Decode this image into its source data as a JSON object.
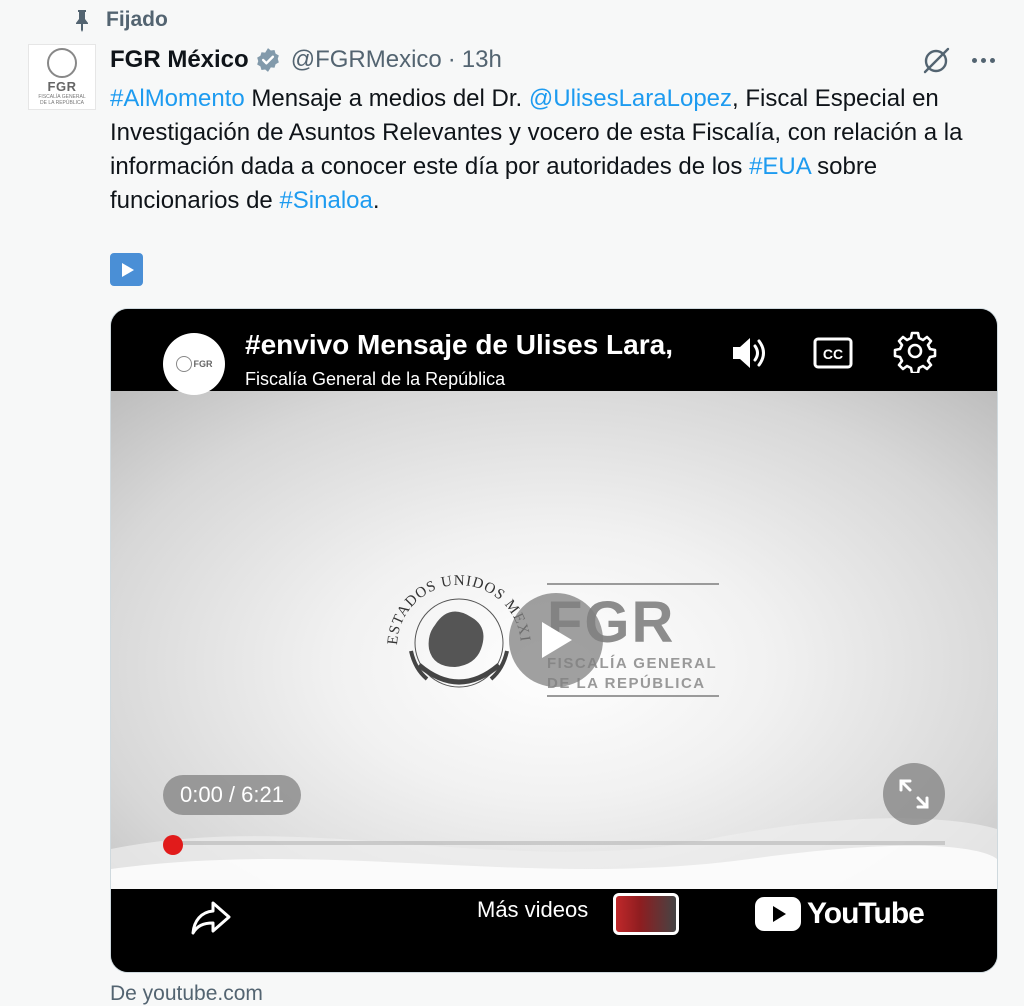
{
  "pinned": {
    "label": "Fijado"
  },
  "author": {
    "avatar_label": "FGR",
    "avatar_sub": "FISCALÍA GENERAL\nDE LA REPÚBLICA",
    "name": "FGR México",
    "handle": "@FGRMexico",
    "separator": "·",
    "time": "13h"
  },
  "tweet": {
    "segments": [
      {
        "text": "#AlMomento",
        "link": true
      },
      {
        "text": " Mensaje a medios del Dr. ",
        "link": false
      },
      {
        "text": "@UlisesLaraLopez",
        "link": true
      },
      {
        "text": ", Fiscal Especial en Investigación de Asuntos Relevantes y vocero de esta Fiscalía, con relación a la información dada a conocer este día por autoridades de los ",
        "link": false
      },
      {
        "text": "#EUA",
        "link": true
      },
      {
        "text": " sobre funcionarios de ",
        "link": false
      },
      {
        "text": "#Sinaloa",
        "link": true
      },
      {
        "text": ".",
        "link": false
      }
    ]
  },
  "video": {
    "channel_avatar_label": "FGR",
    "title": "#envivo Mensaje de Ulises Lara, ",
    "channel": "Fiscalía General de la República",
    "logo_big": "FGR",
    "logo_line1": "FISCALÍA GENERAL",
    "logo_line2": "DE LA REPÚBLICA",
    "seal_text": "ESTADOS UNIDOS MEXICANOS",
    "time_display": "0:00 / 6:21",
    "progress": 0,
    "more_videos": "Más videos",
    "youtube_word": "YouTube"
  },
  "source": {
    "label": "De youtube.com"
  },
  "colors": {
    "link": "#1d9bf0",
    "secondary": "#536471",
    "verified": "#829aab",
    "progress_dot": "#e11b1b",
    "youtube_red": "#ffffff"
  }
}
